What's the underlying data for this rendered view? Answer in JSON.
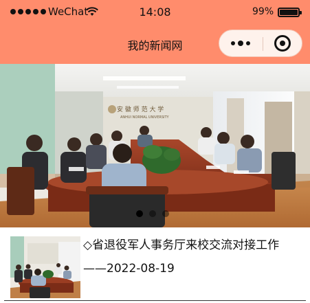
{
  "status_bar": {
    "carrier": "WeChat",
    "time": "14:08",
    "battery_percent": "99%",
    "battery_level": 0.99,
    "signal_icon": "signal-dots-icon",
    "wifi_icon": "wifi-icon",
    "battery_icon": "battery-icon"
  },
  "nav": {
    "title": "我的新闻网",
    "more_icon": "more-dots-icon",
    "close_icon": "target-circle-icon",
    "bar_color": "#ff8c6c"
  },
  "banner": {
    "slide_count": 3,
    "active_slide": 1,
    "logo_text": "ANHUI NORMAL UNIVERSITY"
  },
  "news": [
    {
      "title": "◇省退役军人事务厅来校交流对接工作",
      "date": "——2022-08-19"
    }
  ]
}
